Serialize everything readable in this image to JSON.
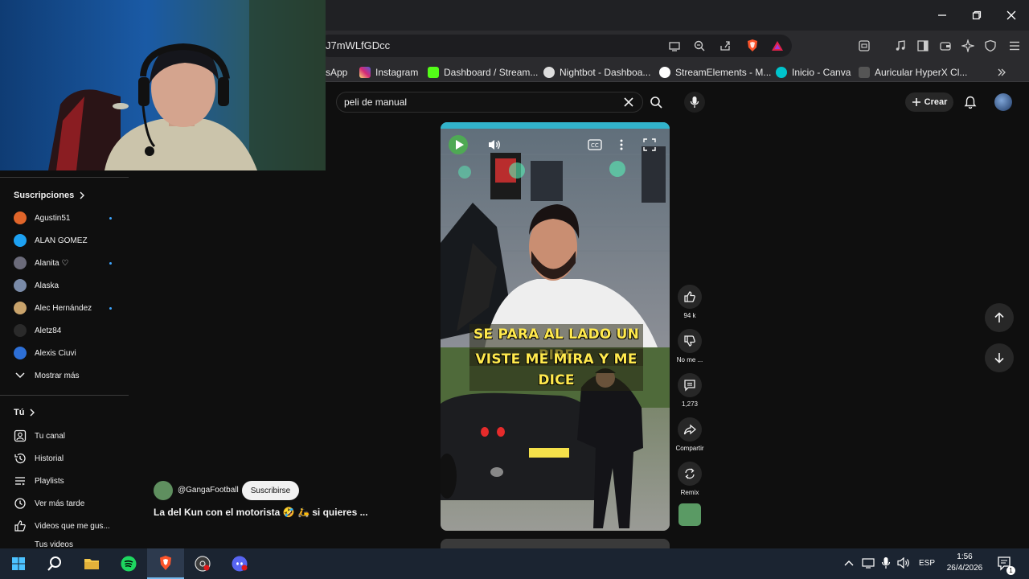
{
  "browser": {
    "url_fragment": "J7mWLfGDcc",
    "bookmarks": [
      {
        "label": "sApp",
        "color": "#25d366"
      },
      {
        "label": "Instagram",
        "color": "#e1306c"
      },
      {
        "label": "Dashboard / Stream...",
        "color": "#53fc18"
      },
      {
        "label": "Nightbot - Dashboa...",
        "color": "#dddddd"
      },
      {
        "label": "StreamElements - M...",
        "color": "#ffffff"
      },
      {
        "label": "Inicio - Canva",
        "color": "#00c4cc"
      },
      {
        "label": "Auricular HyperX Cl...",
        "color": "#555555"
      }
    ]
  },
  "youtube": {
    "search_query": "peli de manual",
    "create_label": "Crear"
  },
  "sidebar": {
    "subscriptions_title": "Suscripciones",
    "subscriptions": [
      {
        "name": "Agustin51",
        "color": "#e0652a",
        "dot": true
      },
      {
        "name": "ALAN GOMEZ",
        "color": "#1da1f2",
        "dot": false
      },
      {
        "name": "Alanita ♡",
        "color": "#6b6b7a",
        "dot": true
      },
      {
        "name": "Alaska",
        "color": "#7a8ba8",
        "dot": false
      },
      {
        "name": "Alec Hernández",
        "color": "#c9a36b",
        "dot": true
      },
      {
        "name": "Aletz84",
        "color": "#2a2a2a",
        "dot": false
      },
      {
        "name": "Alexis Ciuvi",
        "color": "#2d6fd6",
        "dot": false
      }
    ],
    "show_more": "Mostrar más",
    "you_title": "Tú",
    "you_items": [
      "Tu canal",
      "Historial",
      "Playlists",
      "Ver más tarde",
      "Videos que me gus...",
      "Tus videos"
    ]
  },
  "short": {
    "caption_line1": "SE PARA AL LADO UN PIBE",
    "caption_line2": "VISTE ME MIRA Y ME DICE",
    "likes": "94 k",
    "dislike_label": "No me ...",
    "comments": "1,273",
    "share_label": "Compartir",
    "remix_label": "Remix",
    "channel": "@GangaFootball",
    "subscribe_label": "Suscribirse",
    "title": "La del Kun con el motorista 🤣 🛵 si quieres ..."
  },
  "taskbar": {
    "language": "ESP",
    "time": "1:56",
    "date": "26/4/2026",
    "notification_count": "1"
  }
}
